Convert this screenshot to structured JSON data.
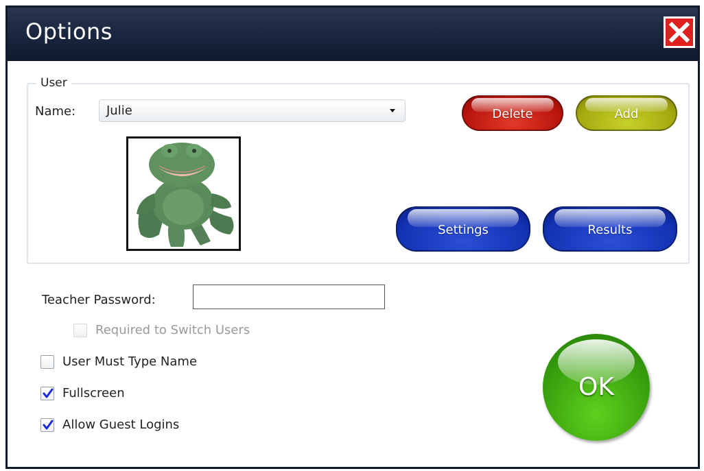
{
  "window": {
    "title": "Options"
  },
  "user_group": {
    "legend": "User",
    "name_label": "Name:",
    "selected_user": "Julie",
    "avatar": "frog-puppet-image",
    "buttons": {
      "delete": "Delete",
      "add": "Add",
      "settings": "Settings",
      "results": "Results"
    }
  },
  "teacher_password": {
    "label": "Teacher Password:",
    "value": ""
  },
  "checkboxes": {
    "required_switch": {
      "label": "Required to Switch Users",
      "checked": false,
      "enabled": false
    },
    "must_type_name": {
      "label": "User Must Type Name",
      "checked": false,
      "enabled": true
    },
    "fullscreen": {
      "label": "Fullscreen",
      "checked": true,
      "enabled": true
    },
    "guest_logins": {
      "label": "Allow Guest Logins",
      "checked": true,
      "enabled": true
    }
  },
  "ok_button": {
    "label": "OK"
  },
  "colors": {
    "titlebar": "#1b2740",
    "close": "#e01f1f",
    "delete": "#b8140c",
    "add": "#a3a80e",
    "blue_buttons": "#1332b4",
    "ok": "#3aa40e",
    "check": "#1b2ad8"
  },
  "icons": {
    "close": "close-x-icon",
    "check": "checkmark-icon",
    "dropdown": "chevron-down-icon"
  }
}
